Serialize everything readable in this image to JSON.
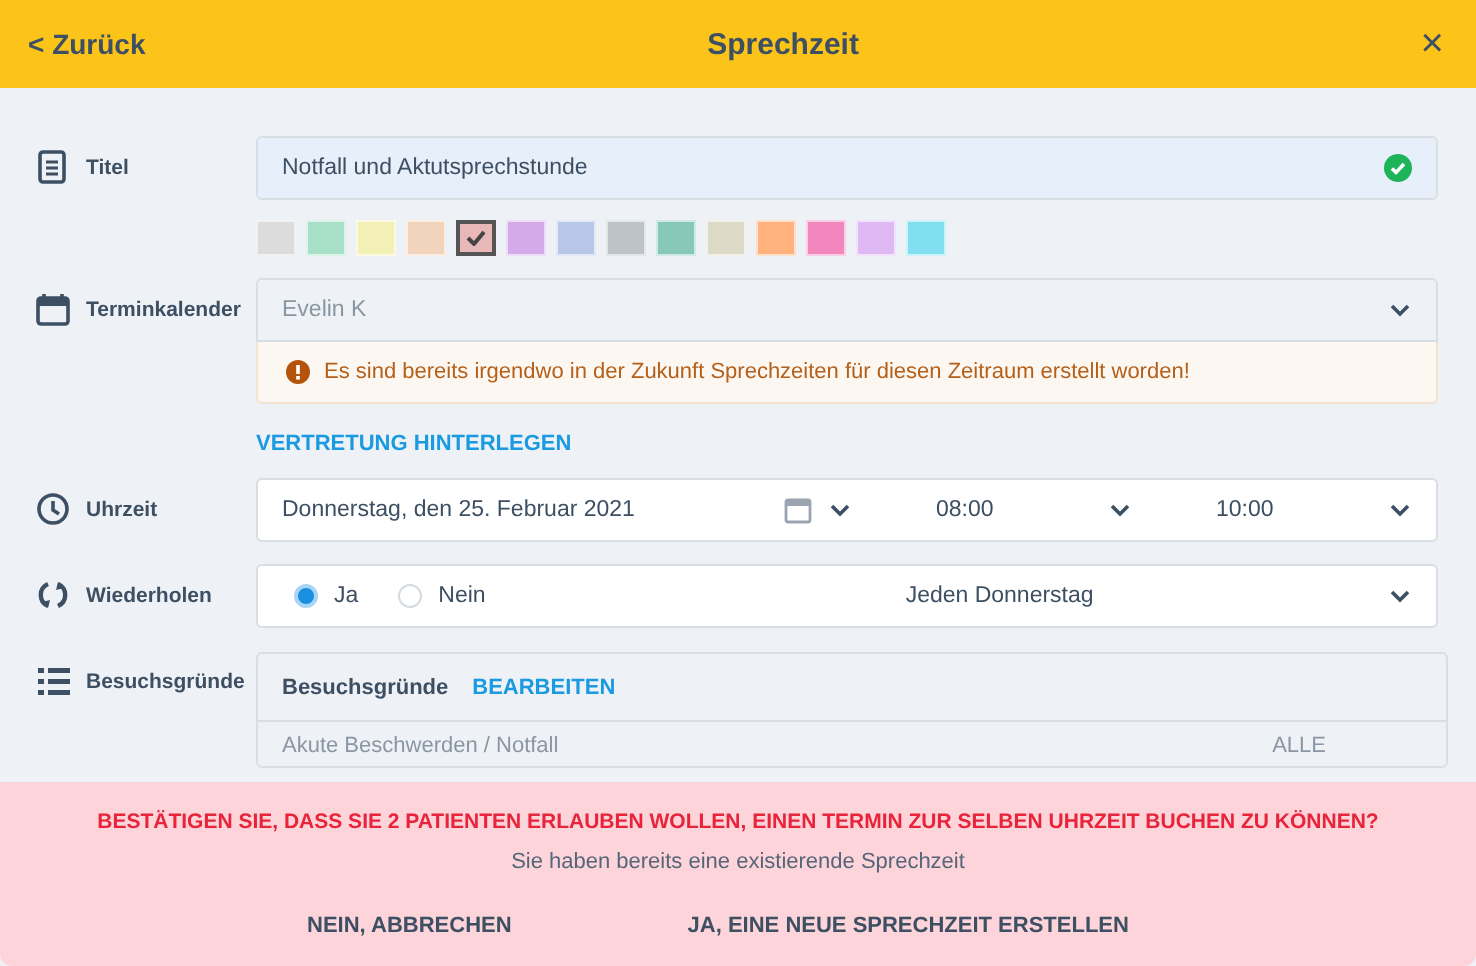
{
  "header": {
    "back": "< Zurück",
    "title": "Sprechzeit",
    "close": "×"
  },
  "title_field": {
    "label": "Titel",
    "value": "Notfall und Aktutsprechstunde",
    "valid": true
  },
  "colors": [
    {
      "color": "#dcdcdc",
      "selected": false
    },
    {
      "color": "#a8e0c8",
      "selected": false
    },
    {
      "color": "#f2f0b4",
      "selected": false
    },
    {
      "color": "#f2d4bc",
      "selected": false
    },
    {
      "color": "#e8b8b8",
      "selected": true
    },
    {
      "color": "#d4aae8",
      "selected": false
    },
    {
      "color": "#b8c7e8",
      "selected": false
    },
    {
      "color": "#bcc3c9",
      "selected": false
    },
    {
      "color": "#88c8bb",
      "selected": false
    },
    {
      "color": "#dcd9c7",
      "selected": false
    },
    {
      "color": "#ffb27e",
      "selected": false
    },
    {
      "color": "#f286bd",
      "selected": false
    },
    {
      "color": "#dfb9f3",
      "selected": false
    },
    {
      "color": "#81dff0",
      "selected": false
    }
  ],
  "calendar": {
    "label": "Terminkalender",
    "value": "Evelin K",
    "warning": "Es sind bereits irgendwo in der Zukunft Sprechzeiten für diesen Zeitraum erstellt worden!",
    "link": "VERTRETUNG HINTERLEGEN"
  },
  "time": {
    "label": "Uhrzeit",
    "date": "Donnerstag, den 25. Februar 2021",
    "start": "08:00",
    "end": "10:00"
  },
  "repeat": {
    "label": "Wiederholen",
    "options": [
      {
        "label": "Ja",
        "selected": true
      },
      {
        "label": "Nein",
        "selected": false
      }
    ],
    "interval": "Jeden Donnerstag"
  },
  "reasons": {
    "label": "Besuchsgründe",
    "heading": "Besuchsgründe",
    "edit": "BEARBEITEN",
    "rows": [
      {
        "name": "Akute Beschwerden / Notfall",
        "value": "ALLE"
      }
    ]
  },
  "confirm": {
    "question": "BESTÄTIGEN SIE, DASS SIE 2 PATIENTEN ERLAUBEN WOLLEN, EINEN TERMIN ZUR SELBEN UHRZEIT BUCHEN ZU KÖNNEN?",
    "note": "Sie haben bereits eine existierende Sprechzeit",
    "buttons": [
      "NEIN, ABBRECHEN",
      "JA, EINE NEUE SPRECHZEIT ERSTELLEN"
    ]
  }
}
